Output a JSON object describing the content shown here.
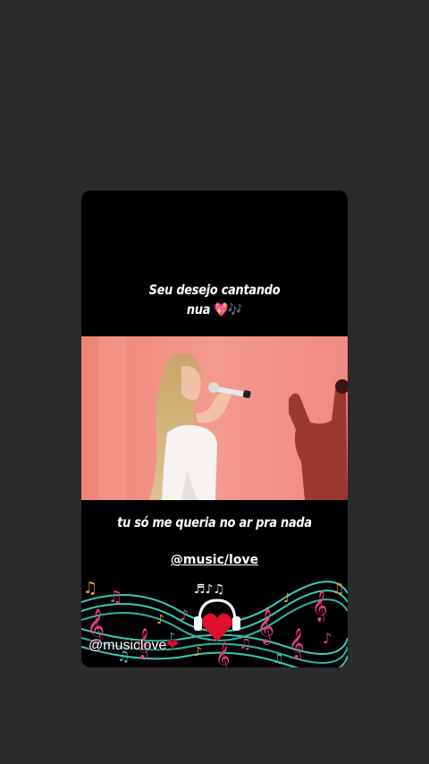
{
  "story": {
    "caption_top_line1": "Seu desejo cantando",
    "caption_top_line2": "nua",
    "caption_top_emoji": "💖",
    "caption_top_notes": "🎶",
    "caption_lyric": "tu só me queria no ar pra nada",
    "handle_link": "@music/love",
    "sticker_handle": "@musiclove",
    "sticker_heart": "❤"
  },
  "colors": {
    "background": "#2b2b2b",
    "story_bg": "#000000",
    "video_bg": "#f28f85",
    "note_pink": "#e8407a",
    "note_teal": "#3cc7b8",
    "heart_red": "#e0102a"
  }
}
